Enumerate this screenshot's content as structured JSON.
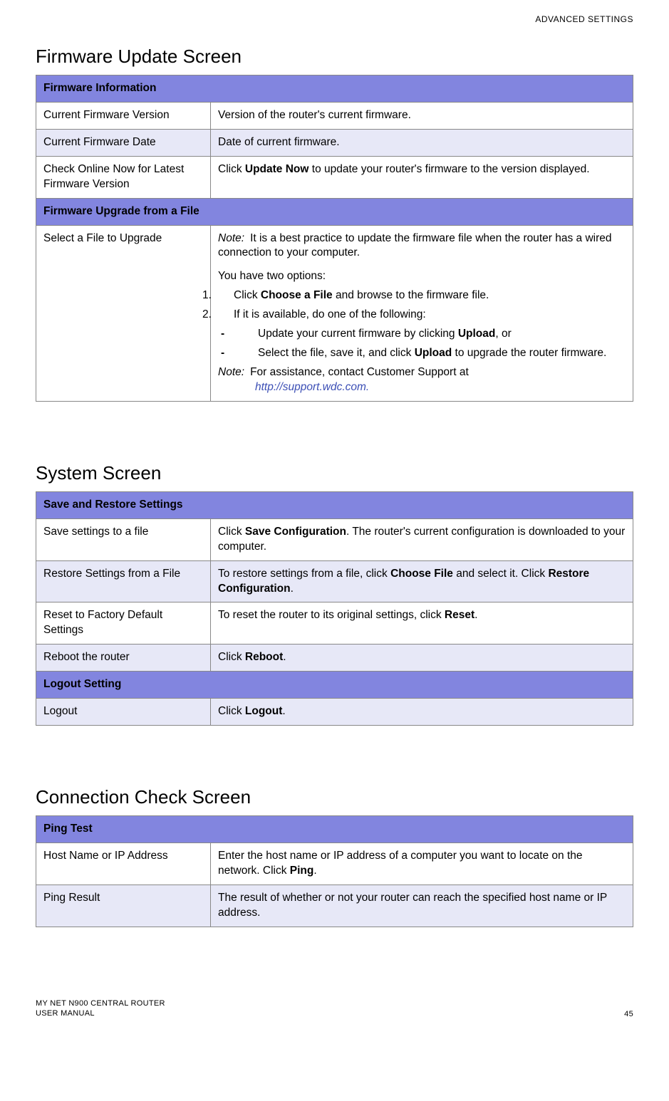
{
  "header_right": "ADVANCED SETTINGS",
  "sections": {
    "firmware": {
      "heading": "Firmware Update Screen",
      "group1_header": "Firmware Information",
      "row1_left": "Current Firmware Version",
      "row1_right": "Version of the router's current firmware.",
      "row2_left": "Current Firmware Date",
      "row2_right": "Date of current firmware.",
      "row3_left": "Check Online Now for Latest Firmware Version",
      "row3_right_pre": "Click ",
      "row3_right_bold": "Update Now",
      "row3_right_post": " to update your router's firmware to the version displayed.",
      "group2_header": "Firmware Upgrade from a File",
      "row4_left": "Select a File to Upgrade",
      "row4_note_label": "Note:",
      "row4_note_text": "It is a best practice to update the firmware file when the router has a wired connection to your computer.",
      "row4_you_have": "You have two options:",
      "row4_li1_pre": "Click ",
      "row4_li1_bold": "Choose a File",
      "row4_li1_post": " and browse to the firmware file.",
      "row4_li2": "If it is available, do one of the following:",
      "row4_sub1_pre": "Update your current firmware by clicking ",
      "row4_sub1_bold": "Upload",
      "row4_sub1_post": ", or",
      "row4_sub2_pre": "Select the file, save it, and click ",
      "row4_sub2_bold": "Upload",
      "row4_sub2_post": " to upgrade the router firmware.",
      "row4_note2_label": "Note:",
      "row4_note2_text": "For assistance, contact Customer Support at ",
      "row4_note2_link": "http://support.wdc.com.",
      "num1": "1.",
      "num2": "2.",
      "dash": "-"
    },
    "system": {
      "heading": "System Screen",
      "group1_header": "Save and Restore Settings",
      "row1_left": "Save settings to a file",
      "row1_right_pre": "Click ",
      "row1_right_bold": "Save Configuration",
      "row1_right_post": ". The router's current configuration is downloaded to your computer.",
      "row2_left": "Restore Settings from a File",
      "row2_right_pre": "To restore settings from a file, click ",
      "row2_right_bold1": "Choose File",
      "row2_right_mid": " and select it. Click ",
      "row2_right_bold2": "Restore Configuration",
      "row2_right_post": ".",
      "row3_left": "Reset to Factory Default Settings",
      "row3_right_pre": "To reset the router to its original settings, click ",
      "row3_right_bold": "Reset",
      "row3_right_post": ".",
      "row4_left": "Reboot the router",
      "row4_right_pre": "Click ",
      "row4_right_bold": "Reboot",
      "row4_right_post": ".",
      "group2_header": "Logout Setting",
      "row5_left": "Logout",
      "row5_right_pre": "Click ",
      "row5_right_bold": "Logout",
      "row5_right_post": "."
    },
    "connection": {
      "heading": "Connection Check Screen",
      "group1_header": "Ping Test",
      "row1_left": "Host Name or IP Address",
      "row1_right_pre": "Enter the host name or IP address of a computer you want to locate on the network. Click ",
      "row1_right_bold": "Ping",
      "row1_right_post": ".",
      "row2_left": "Ping Result",
      "row2_right": "The result of whether or not your router can reach the specified host name or IP address."
    }
  },
  "footer": {
    "left1": "MY NET N900 CENTRAL ROUTER",
    "left2": "USER MANUAL",
    "right": "45"
  }
}
